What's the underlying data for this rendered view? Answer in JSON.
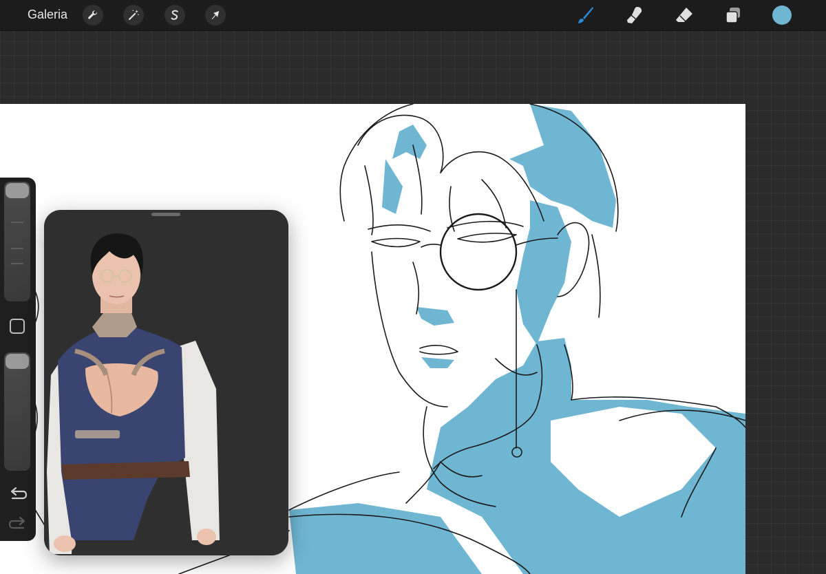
{
  "toolbar": {
    "gallery_label": "Galeria",
    "left_tools": [
      {
        "name": "actions",
        "icon": "wrench-icon"
      },
      {
        "name": "adjustments",
        "icon": "magic-wand-icon"
      },
      {
        "name": "selection",
        "icon": "selection-s-icon"
      },
      {
        "name": "transform",
        "icon": "arrow-cursor-icon"
      }
    ],
    "right_tools": [
      {
        "name": "brush",
        "icon": "brush-icon",
        "active": true
      },
      {
        "name": "smudge",
        "icon": "smudge-finger-icon",
        "active": false
      },
      {
        "name": "eraser",
        "icon": "eraser-icon",
        "active": false
      },
      {
        "name": "layers",
        "icon": "layers-icon",
        "active": false
      }
    ],
    "current_color": "#6fb6d3",
    "active_tool_color": "#2a8ad6"
  },
  "sidebar": {
    "brush_size_slider": {
      "icon": "slider-handle"
    },
    "opacity_slider": {
      "icon": "slider-handle"
    },
    "modify_button": {
      "icon": "square-outline-icon"
    },
    "undo": {
      "icon": "undo-icon"
    },
    "redo": {
      "icon": "redo-icon"
    }
  },
  "canvas": {
    "background": "#ffffff",
    "fill_color": "#6fb6d3",
    "line_color": "#1a1a1a"
  },
  "reference_window": {
    "background": "#2f2f2f"
  }
}
